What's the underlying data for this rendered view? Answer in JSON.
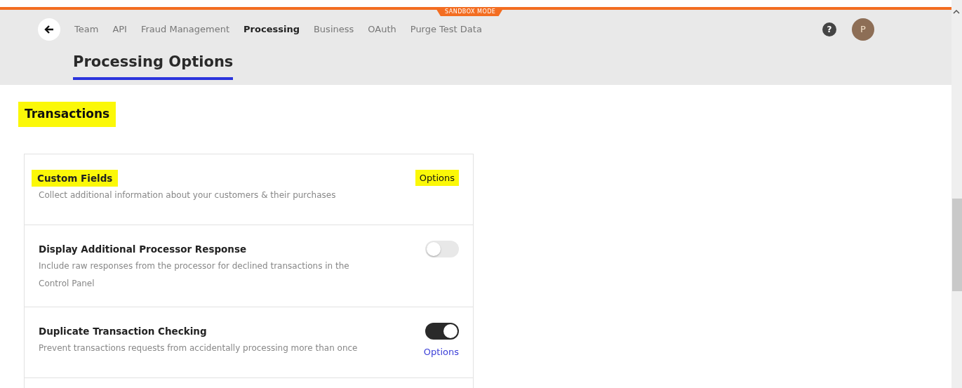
{
  "banner": {
    "label": "SANDBOX MODE"
  },
  "nav": [
    {
      "label": "Team",
      "selected": false
    },
    {
      "label": "API",
      "selected": false
    },
    {
      "label": "Fraud Management",
      "selected": false
    },
    {
      "label": "Processing",
      "selected": true
    },
    {
      "label": "Business",
      "selected": false
    },
    {
      "label": "OAuth",
      "selected": false
    },
    {
      "label": "Purge Test Data",
      "selected": false
    }
  ],
  "help": {
    "label": "?"
  },
  "avatar": {
    "initial": "P"
  },
  "page_tab": {
    "label": "Processing Options",
    "selected": true
  },
  "section": {
    "title": "Transactions",
    "highlighted": true
  },
  "settings": [
    {
      "title": "Custom Fields",
      "title_highlighted": true,
      "description": "Collect additional information about your customers & their purchases",
      "options": {
        "label": "Options",
        "highlighted": true
      }
    },
    {
      "title": "Display Additional Processor Response",
      "title_highlighted": false,
      "description": "Include raw responses from the processor for declined transactions in the Control Panel",
      "toggle": {
        "on": false
      }
    },
    {
      "title": "Duplicate Transaction Checking",
      "title_highlighted": false,
      "description": "Prevent transactions requests from accidentally processing more than once",
      "toggle": {
        "on": true
      },
      "options": {
        "label": "Options",
        "highlighted": false
      }
    }
  ]
}
